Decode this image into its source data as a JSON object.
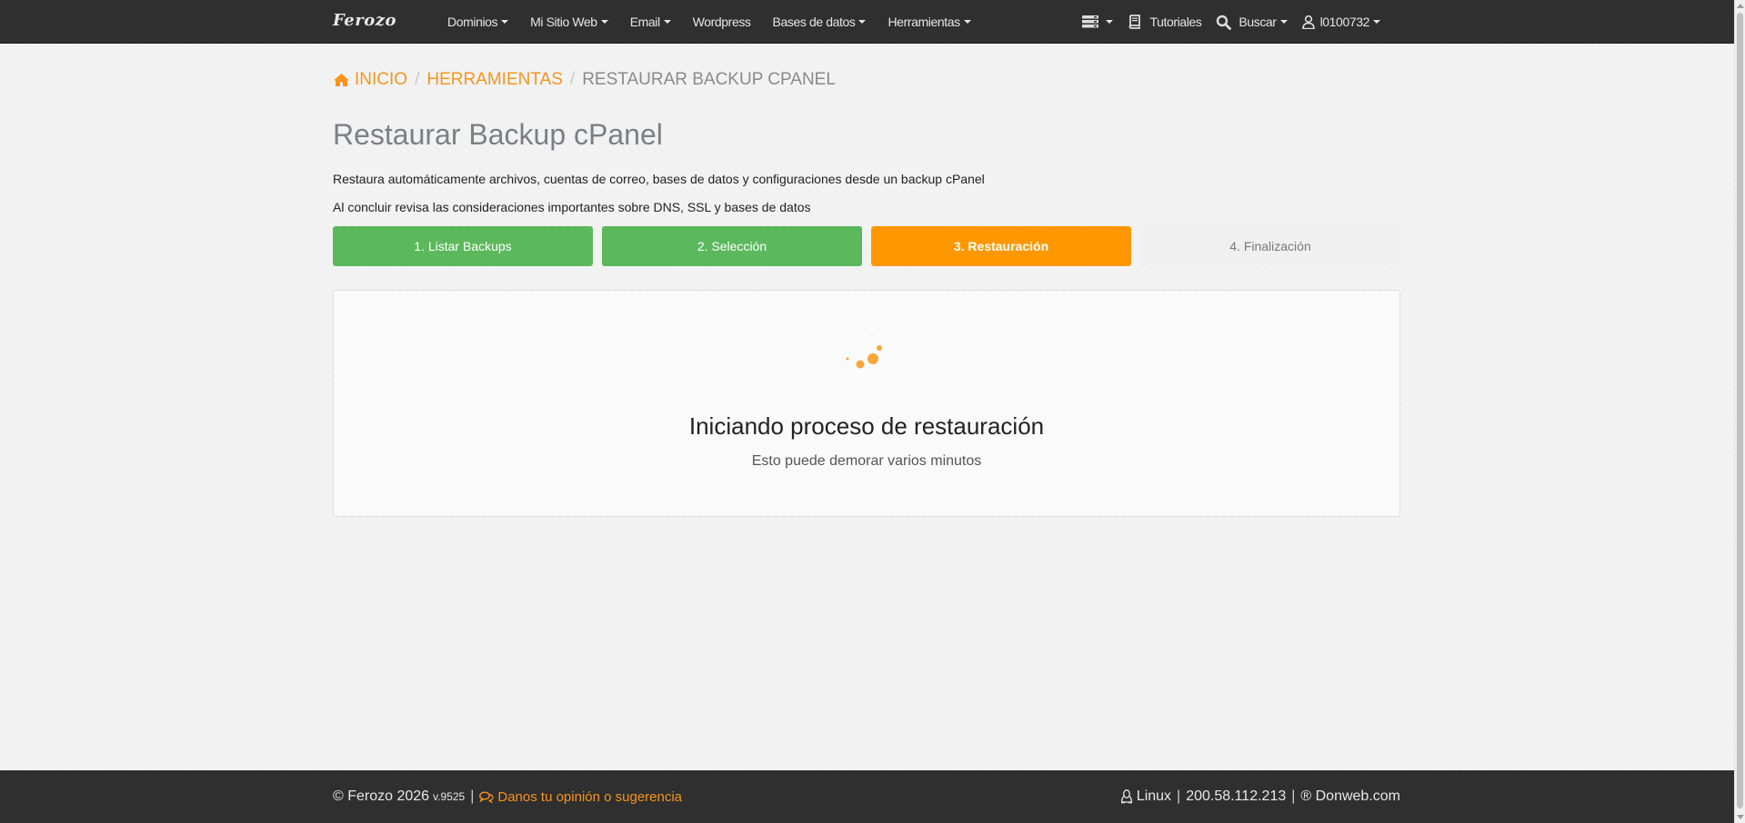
{
  "navbar": {
    "brand": "Ferozo",
    "menu": [
      {
        "label": "Dominios"
      },
      {
        "label": "Mi Sitio Web"
      },
      {
        "label": "Email"
      },
      {
        "label": "Wordpress"
      },
      {
        "label": "Bases de datos"
      },
      {
        "label": "Herramientas"
      }
    ],
    "tutorials_label": "Tutoriales",
    "search_label": "Buscar",
    "user_label": "l0100732"
  },
  "breadcrumb": {
    "home": "INICIO",
    "section": "HERRAMIENTAS",
    "current": "RESTAURAR BACKUP CPANEL"
  },
  "page": {
    "title": "Restaurar Backup cPanel",
    "description_1": "Restaura automáticamente archivos, cuentas de correo, bases de datos y configuraciones desde un backup cPanel",
    "description_2": "Al concluir revisa las consideraciones importantes sobre DNS, SSL y bases de datos"
  },
  "steps": [
    {
      "label": "1. Listar Backups",
      "status": "done"
    },
    {
      "label": "2. Selección",
      "status": "done"
    },
    {
      "label": "3. Restauración",
      "status": "active"
    },
    {
      "label": "4. Finalización",
      "status": "pending"
    }
  ],
  "progress_panel": {
    "title": "Iniciando proceso de restauración",
    "subtitle": "Esto puede demorar varios minutos"
  },
  "footer": {
    "copyright": "© Ferozo 2026",
    "version": "v.9525",
    "feedback": "Danos tu opinión o sugerencia",
    "os": "Linux",
    "ip": "200.58.112.213",
    "provider": "® Donweb.com"
  },
  "colors": {
    "accent": "#f7941d",
    "step_done": "#5cb85c",
    "step_active": "#ff9800",
    "navbar": "#2f2f2f"
  },
  "icons": {
    "home": "home-icon",
    "servers": "server-stack-icon",
    "tutorials": "book-icon",
    "search": "search-icon",
    "user": "user-icon",
    "feedback": "chat-bubbles-icon",
    "linux": "linux-tux-icon",
    "spinner": "loading-spinner-icon"
  }
}
